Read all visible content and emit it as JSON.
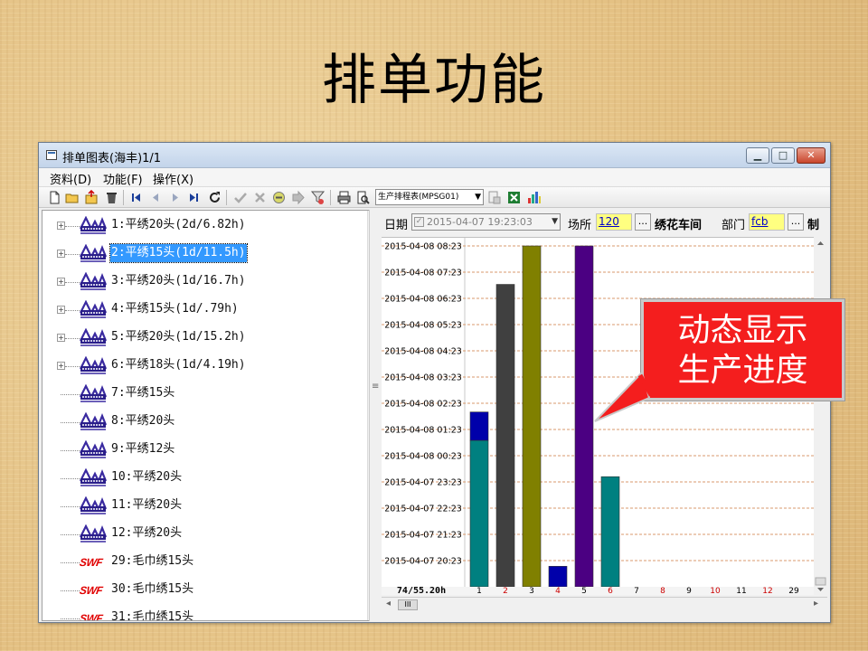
{
  "slide": {
    "title": "排单功能"
  },
  "window": {
    "title": "排单图表(海丰)1/1",
    "controls": {
      "minimize": "▁",
      "maximize": "□",
      "close": "✕"
    }
  },
  "menu": [
    {
      "label": "资料(D)"
    },
    {
      "label": "功能(F)"
    },
    {
      "label": "操作(X)"
    }
  ],
  "toolbar": {
    "icons": [
      "new-icon",
      "open-icon",
      "export-icon",
      "delete-icon",
      "first-icon",
      "prev-icon",
      "next-icon",
      "last-icon",
      "refresh-icon",
      "confirm-icon",
      "cancel-icon",
      "edit-icon",
      "forward-icon",
      "filter-icon",
      "print-icon",
      "preview-icon",
      "settings-icon",
      "excel-icon",
      "chart-icon"
    ],
    "report_select": "生产排程表(MPSG01)"
  },
  "tree": {
    "items": [
      {
        "label": "1:平绣20头(2d/6.82h)",
        "brand": "TAJIMA",
        "expandable": true,
        "selected": false
      },
      {
        "label": "2:平绣15头(1d/11.5h)",
        "brand": "TAJIMA",
        "expandable": true,
        "selected": true
      },
      {
        "label": "3:平绣20头(1d/16.7h)",
        "brand": "TAJIMA",
        "expandable": true,
        "selected": false
      },
      {
        "label": "4:平绣15头(1d/.79h)",
        "brand": "TAJIMA",
        "expandable": true,
        "selected": false
      },
      {
        "label": "5:平绣20头(1d/15.2h)",
        "brand": "TAJIMA",
        "expandable": true,
        "selected": false
      },
      {
        "label": "6:平绣18头(1d/4.19h)",
        "brand": "TAJIMA",
        "expandable": true,
        "selected": false
      },
      {
        "label": "7:平绣15头",
        "brand": "TAJIMA",
        "expandable": false,
        "selected": false
      },
      {
        "label": "8:平绣20头",
        "brand": "TAJIMA",
        "expandable": false,
        "selected": false
      },
      {
        "label": "9:平绣12头",
        "brand": "TAJIMA",
        "expandable": false,
        "selected": false
      },
      {
        "label": "10:平绣20头",
        "brand": "TAJIMA",
        "expandable": false,
        "selected": false
      },
      {
        "label": "11:平绣20头",
        "brand": "TAJIMA",
        "expandable": false,
        "selected": false
      },
      {
        "label": "12:平绣20头",
        "brand": "TAJIMA",
        "expandable": false,
        "selected": false
      },
      {
        "label": "29:毛巾绣15头",
        "brand": "SWF",
        "expandable": false,
        "selected": false
      },
      {
        "label": "30:毛巾绣15头",
        "brand": "SWF",
        "expandable": false,
        "selected": false
      },
      {
        "label": "31:毛巾绣15头",
        "brand": "SWF",
        "expandable": false,
        "selected": false
      }
    ]
  },
  "filter": {
    "date_label": "日期",
    "date_value": "2015-04-07 19:23:03",
    "site_label": "场所",
    "site_value": "120",
    "site_dots": "...",
    "workshop": "绣花车间",
    "dept_label": "部门",
    "dept_value": "fcb",
    "dept_dots": "...",
    "trailing": "制"
  },
  "chart_data": {
    "type": "bar",
    "categories": [
      "1",
      "2",
      "3",
      "4",
      "5",
      "6",
      "7",
      "8",
      "9",
      "10",
      "11",
      "12",
      "29"
    ],
    "y_tick_labels": [
      "2015-04-07 20:23",
      "2015-04-07 21:23",
      "2015-04-07 22:23",
      "2015-04-07 23:23",
      "2015-04-08 00:23",
      "2015-04-08 01:23",
      "2015-04-08 02:23",
      "2015-04-08 03:23",
      "2015-04-08 04:23",
      "2015-04-08 05:23",
      "2015-04-08 06:23",
      "2015-04-08 07:23",
      "2015-04-08 08:23"
    ],
    "ylim": [
      "2015-04-07 19:23",
      "2015-04-08 08:23"
    ],
    "series": [
      {
        "values": [
          {
            "category": "1",
            "segments": [
              {
                "end": "2015-04-08 00:58",
                "color": "#008080"
              },
              {
                "end": "2015-04-08 02:03",
                "color": "#0000aa"
              }
            ]
          },
          {
            "category": "2",
            "segments": [
              {
                "end": "2015-04-08 06:55",
                "color": "#404040"
              }
            ]
          },
          {
            "category": "3",
            "segments": [
              {
                "end": "2015-04-08 08:23",
                "color": "#808000"
              }
            ]
          },
          {
            "category": "4",
            "segments": [
              {
                "end": "2015-04-07 20:10",
                "color": "#0000aa"
              }
            ]
          },
          {
            "category": "5",
            "segments": [
              {
                "end": "2015-04-08 08:23",
                "color": "#4b0082"
              }
            ]
          },
          {
            "category": "6",
            "segments": [
              {
                "end": "2015-04-07 23:35",
                "color": "#008080"
              }
            ]
          }
        ]
      }
    ],
    "odd_label_color": "#000000",
    "even_label_color": "#cc0000",
    "grid": true,
    "gridline_color": "#d99a6c",
    "footer_label": "74/55.20h"
  },
  "callout": {
    "line1": "动态显示",
    "line2": "生产进度",
    "color": "#f41e1e"
  }
}
